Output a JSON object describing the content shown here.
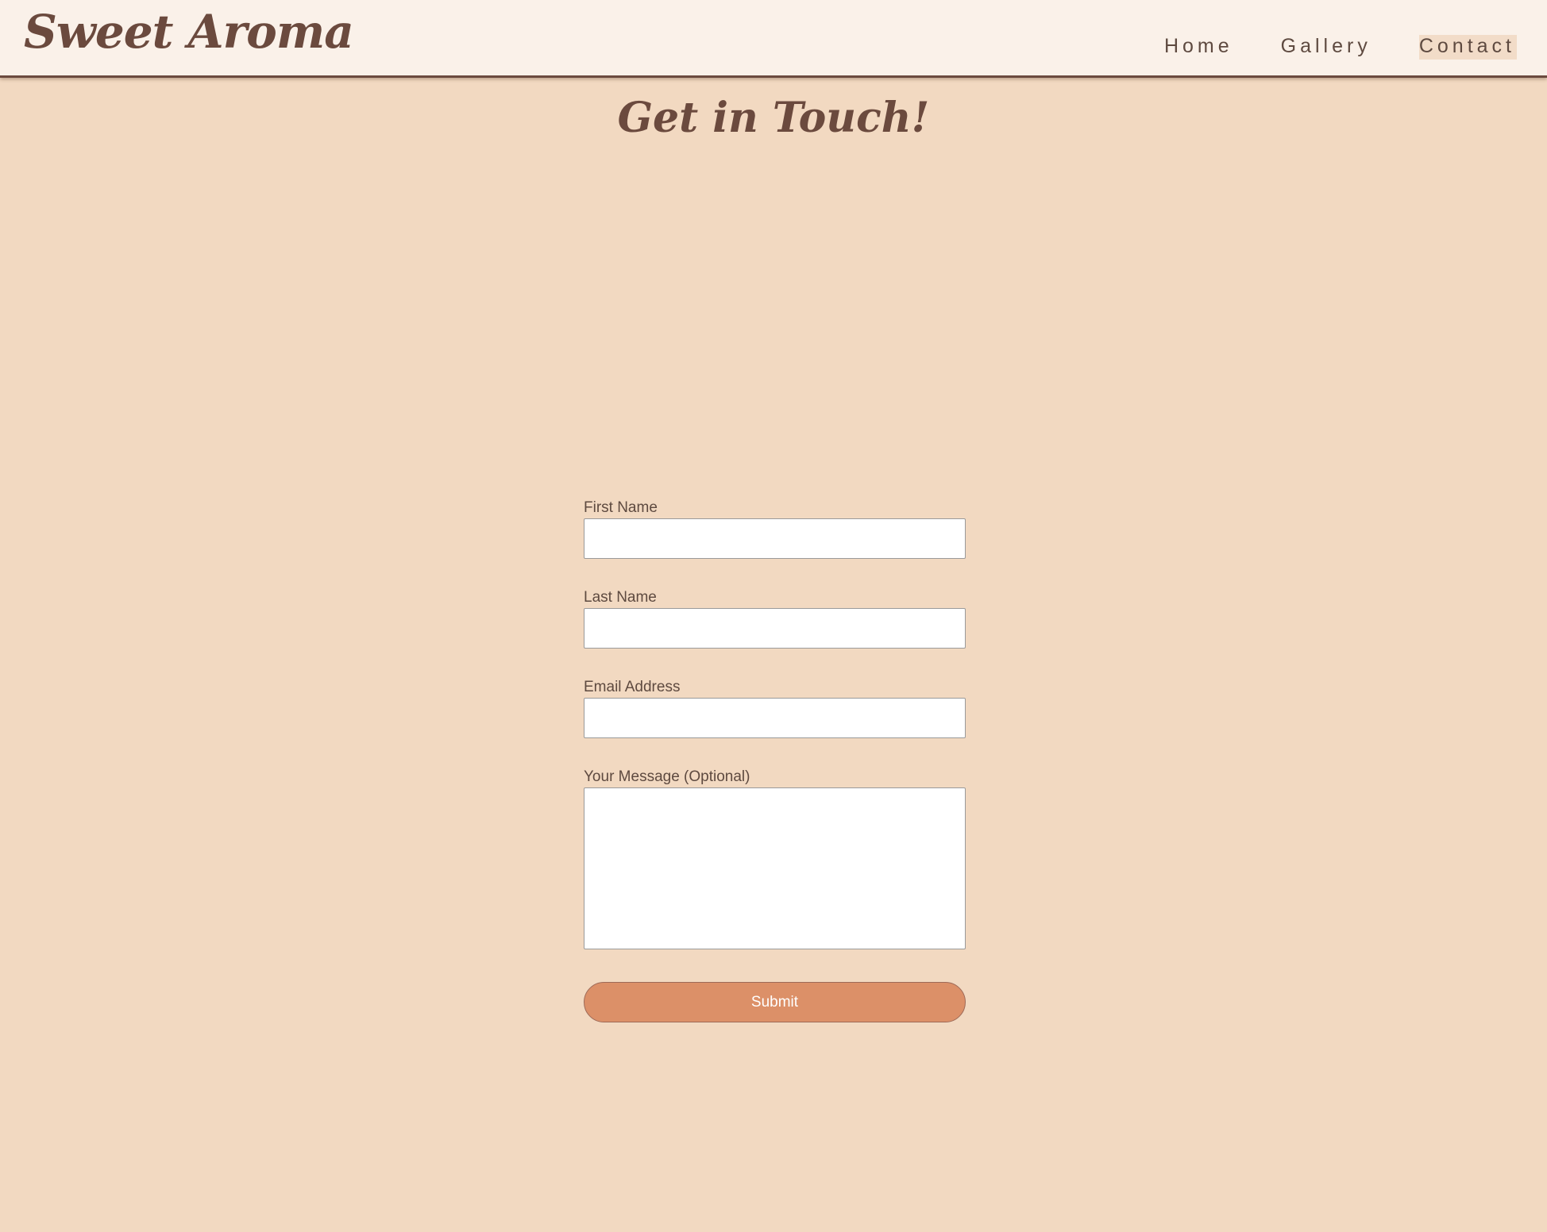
{
  "header": {
    "logo": "Sweet Aroma",
    "nav": [
      {
        "label": "Home",
        "active": false
      },
      {
        "label": "Gallery",
        "active": false
      },
      {
        "label": "Contact",
        "active": true
      }
    ]
  },
  "main": {
    "title": "Get in Touch!",
    "form": {
      "first_name_label": "First Name",
      "first_name_value": "",
      "last_name_label": "Last Name",
      "last_name_value": "",
      "email_label": "Email Address",
      "email_value": "",
      "message_label": "Your Message (Optional)",
      "message_value": "",
      "submit_label": "Submit"
    }
  },
  "colors": {
    "background": "#f2d9c1",
    "header_background": "#faf1e9",
    "brand_brown": "#6b4a3e",
    "button": "#dc9068"
  }
}
